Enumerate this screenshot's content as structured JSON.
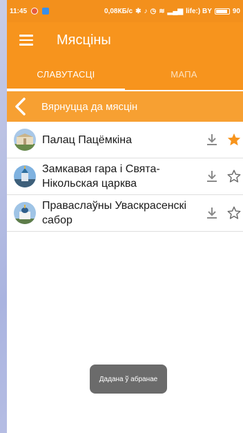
{
  "status_bar": {
    "time": "11:45",
    "network_speed": "0,08КБ/с",
    "carrier": "life:) BY",
    "battery": "90"
  },
  "app_bar": {
    "title": "Мясціны",
    "menu_icon": "hamburger-menu-icon"
  },
  "tabs": [
    {
      "label": "СЛАВУТАСЦІ",
      "active": true
    },
    {
      "label": "МАПА",
      "active": false
    }
  ],
  "back_bar": {
    "label": "Вярнуцца да мясцін",
    "icon": "chevron-left-icon"
  },
  "places": [
    {
      "name": "Палац Пацёмкіна",
      "favorite": true
    },
    {
      "name": "Замкавая гара і Свята-Нікольская царква",
      "favorite": false
    },
    {
      "name": "Праваслаўны Уваскрасенскі сабор",
      "favorite": false
    }
  ],
  "toast": {
    "text": "Дадана ў абранае"
  },
  "colors": {
    "accent": "#f7941d",
    "accent_light": "#f7a032",
    "star_filled": "#f7941d",
    "icon_gray": "#8a8a8a"
  }
}
